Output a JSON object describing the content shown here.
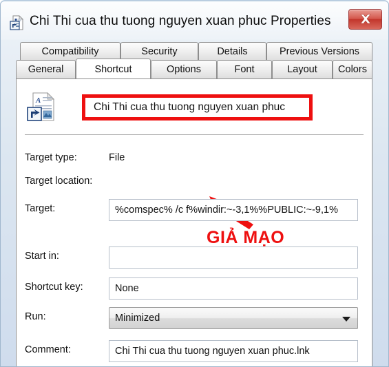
{
  "window": {
    "title": "Chi Thi cua thu tuong nguyen xuan phuc Properties",
    "title_icon": "shortcut-document-icon",
    "close_label": "Close",
    "frame_color": "#cfdced",
    "close_color": "#c2352b"
  },
  "tabs": {
    "row1": [
      {
        "label": "Compatibility",
        "active": false
      },
      {
        "label": "Security",
        "active": false
      },
      {
        "label": "Details",
        "active": false
      },
      {
        "label": "Previous Versions",
        "active": false
      }
    ],
    "row2": [
      {
        "label": "General",
        "active": false
      },
      {
        "label": "Shortcut",
        "active": true
      },
      {
        "label": "Options",
        "active": false
      },
      {
        "label": "Font",
        "active": false
      },
      {
        "label": "Layout",
        "active": false
      },
      {
        "label": "Colors",
        "active": false
      }
    ]
  },
  "shortcut_tab": {
    "icon": "shortcut-document-icon",
    "name_value": "Chi Thi cua thu tuong nguyen xuan phuc",
    "fields": {
      "target_type_label": "Target type:",
      "target_type_value": "File",
      "target_location_label": "Target location:",
      "target_location_value": "",
      "target_label": "Target:",
      "target_value": "%comspec% /c f%windir:~-3,1%%PUBLIC:~-9,1%",
      "start_in_label": "Start in:",
      "start_in_value": "",
      "shortcut_key_label": "Shortcut key:",
      "shortcut_key_value": "None",
      "run_label": "Run:",
      "run_value": "Minimized",
      "comment_label": "Comment:",
      "comment_value": "Chi Thi cua thu tuong nguyen xuan phuc.lnk"
    }
  },
  "annotation": {
    "text": "GIẢ MẠO",
    "color": "#ee1010",
    "arrow": "red-arrow-up-left",
    "highlight_color": "#ee1010"
  }
}
